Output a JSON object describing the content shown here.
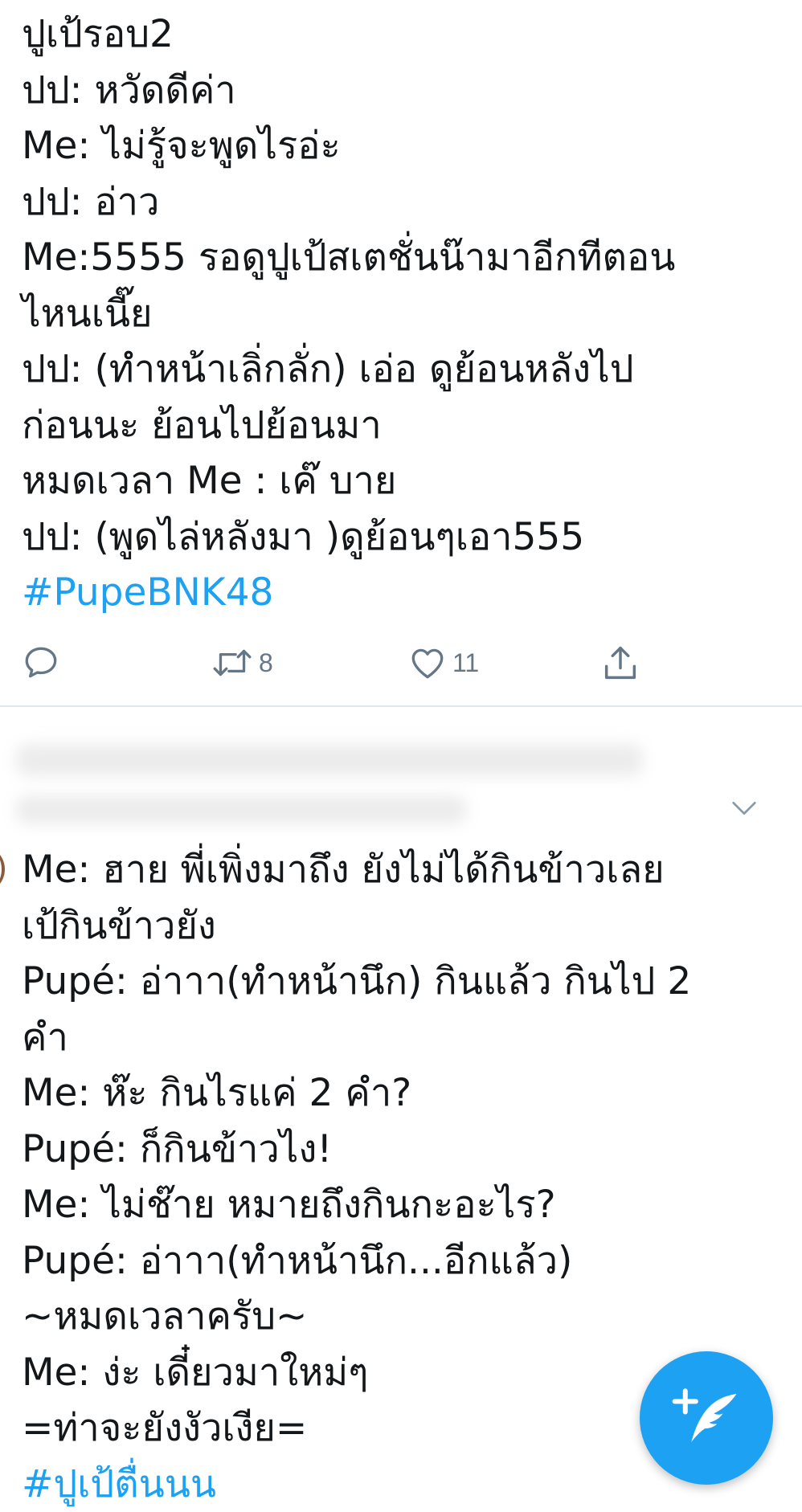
{
  "tweet1": {
    "lines": [
      "ปูเป้รอบ2",
      "ปป: หวัดดีค่า",
      "Me: ไม่รู้จะพูดไรอ่ะ",
      "ปป: อ่าว",
      "Me:5555 รอดูปูเป้สเตชั่นน๊ามาอีกทีตอน",
      "ไหนเนี๊ย",
      "ปป: (ทำหน้าเลิ่กลั่ก) เอ่อ ดูย้อนหลังไป",
      "ก่อนนะ ย้อนไปย้อนมา",
      "หมดเวลา Me : เค๊ บาย",
      "ปป: (พูดไล่หลังมา )ดูย้อนๆเอา555"
    ],
    "hashtag": "#PupeBNK48",
    "actions": {
      "reply_icon": "reply-icon",
      "retweet_icon": "retweet-icon",
      "retweet_count": "8",
      "like_icon": "heart-icon",
      "like_count": "11",
      "share_icon": "share-icon"
    }
  },
  "tweet2": {
    "lines": [
      "Me: ฮาย พี่เพิ่งมาถึง ยังไม่ได้กินข้าวเลย",
      "เป้กินข้าวยัง",
      "Pupé: อ่าาา(ทำหน้านึก) กินแล้ว กินไป 2",
      "คำ",
      "Me: ห๊ะ กินไรแค่ 2 คำ?",
      "Pupé: ก็กินข้าวไง!",
      "Me: ไม่ช๊าย หมายถึงกินกะอะไร?",
      "Pupé: อ่าาา(ทำหน้านึก...อีกแล้ว)",
      "~หมดเวลาครับ~",
      "Me: ง่ะ เดี๋ยวมาใหม่ๆ",
      "=ท่าจะยังงัวเงีย="
    ],
    "hashtag": "#ปูเป้ตื่นนน",
    "menu_icon": "chevron-down-icon"
  },
  "fab": {
    "icon": "compose-tweet-icon"
  },
  "colors": {
    "text": "#14171a",
    "accent": "#1da1f2",
    "secondary": "#657786",
    "divider": "#e1e8ed"
  }
}
